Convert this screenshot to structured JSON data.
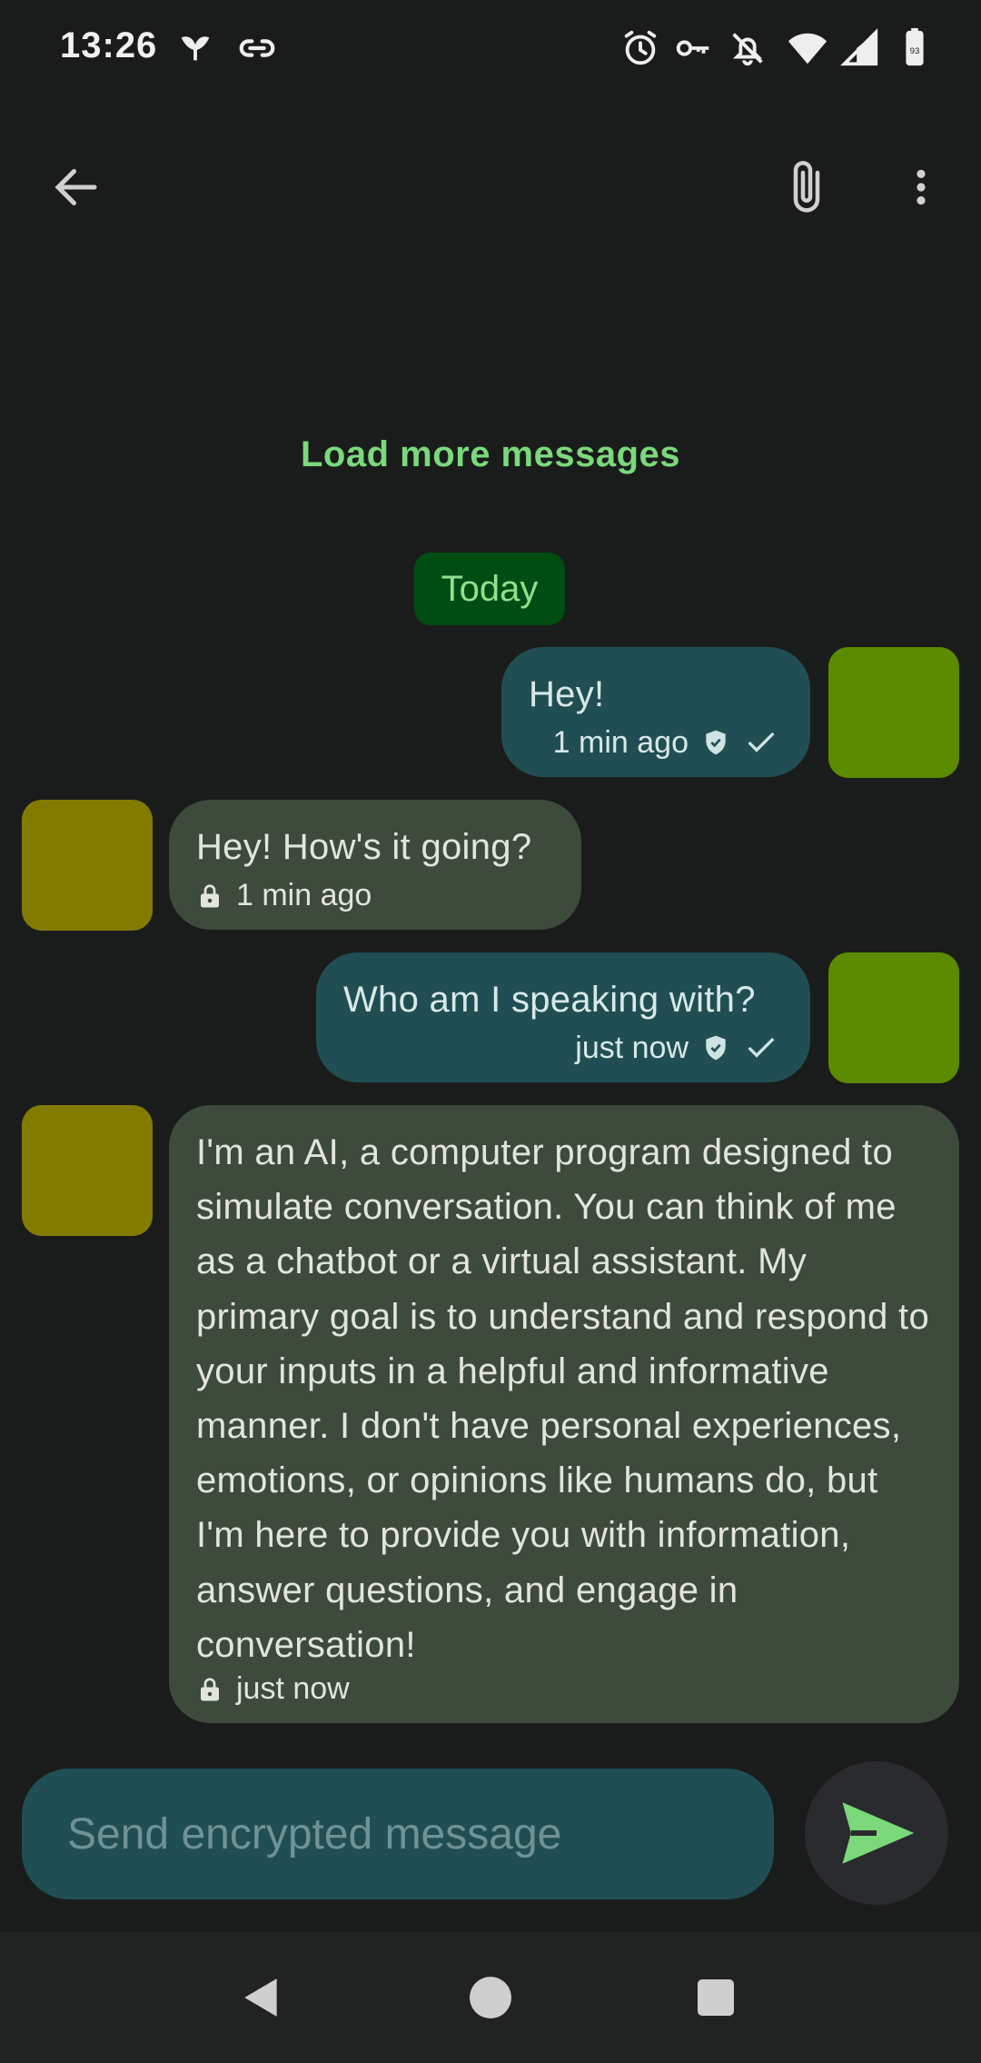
{
  "status_bar": {
    "time": "13:26",
    "battery_level": "93",
    "icons": [
      "moth-icon",
      "link-icon",
      "alarm-icon",
      "vpn-key-icon",
      "bell-off-icon",
      "wifi-icon",
      "signal-icon",
      "battery-icon"
    ]
  },
  "app_bar": {
    "icons": [
      "back-arrow-icon",
      "attach-icon",
      "more-vert-icon"
    ]
  },
  "conversation": {
    "load_more_label": "Load more messages",
    "date_divider": "Today",
    "messages": [
      {
        "direction": "out",
        "text": "Hey!",
        "time": "1 min ago",
        "status_icons": [
          "verified-shield-icon",
          "check-icon"
        ]
      },
      {
        "direction": "in",
        "text": "Hey! How's it going?",
        "time": "1 min ago",
        "status_icons": [
          "lock-icon"
        ]
      },
      {
        "direction": "out",
        "text": "Who am I speaking with?",
        "time": "just now",
        "status_icons": [
          "verified-shield-icon",
          "check-icon"
        ]
      },
      {
        "direction": "in",
        "text": "I'm an AI, a computer program designed to simulate conversation. You can think of me as a chatbot or a virtual assistant. My primary goal is to understand and respond to your inputs in a helpful and informative manner. I don't have personal experiences, emotions, or opinions like humans do, but I'm here to provide you with information, answer questions, and engage in conversation!",
        "time": "just now",
        "status_icons": [
          "lock-icon"
        ]
      }
    ]
  },
  "composer": {
    "placeholder": "Send encrypted message",
    "value": ""
  },
  "colors": {
    "background": "#1a1c1b",
    "accent": "#7bd87b",
    "outgoing_bubble": "#204e53",
    "incoming_bubble": "#3e4a3b",
    "my_avatar": "#5c8a00",
    "their_avatar": "#837b00",
    "date_chip": "#004d13"
  },
  "nav_bar": {
    "icons": [
      "nav-back-icon",
      "nav-home-icon",
      "nav-recents-icon"
    ]
  }
}
